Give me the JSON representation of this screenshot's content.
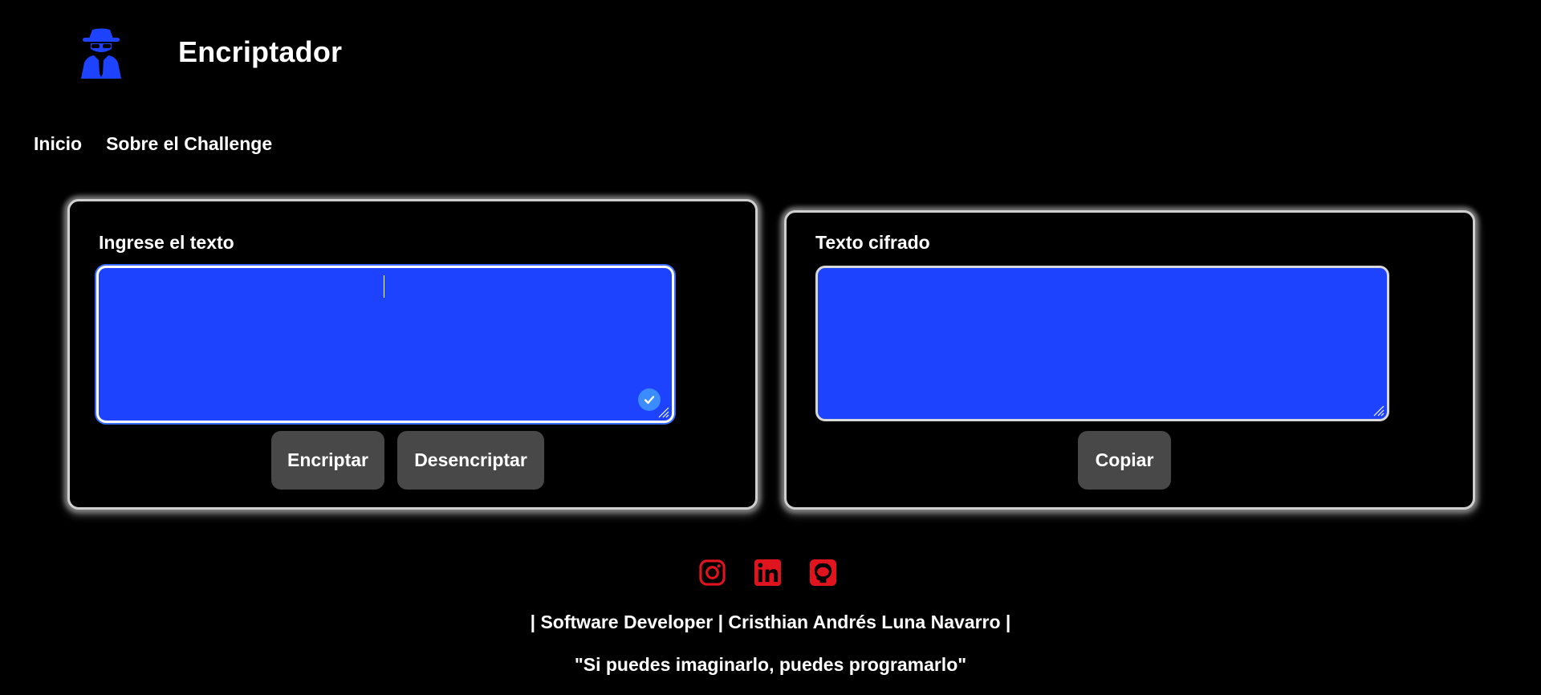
{
  "header": {
    "logo_icon": "spy-agent-icon",
    "title": "Encriptador",
    "accent_color": "#1e43ff"
  },
  "nav": {
    "items": [
      {
        "label": "Inicio"
      },
      {
        "label": "Sobre el Challenge"
      }
    ]
  },
  "input_panel": {
    "label": "Ingrese el texto",
    "value": "",
    "encrypt_label": "Encriptar",
    "decrypt_label": "Desencriptar"
  },
  "output_panel": {
    "label": "Texto cifrado",
    "value": "",
    "copy_label": "Copiar"
  },
  "footer": {
    "social_icons": [
      "instagram-icon",
      "linkedin-icon",
      "github-icon"
    ],
    "social_color": "#e0141e",
    "credit": "| Software Developer | Cristhian Andrés Luna Navarro |",
    "quote": "\"Si puedes imaginarlo, puedes programarlo\""
  },
  "colors": {
    "background": "#000000",
    "textarea_bg": "#1e43ff",
    "button_bg": "#484848"
  }
}
